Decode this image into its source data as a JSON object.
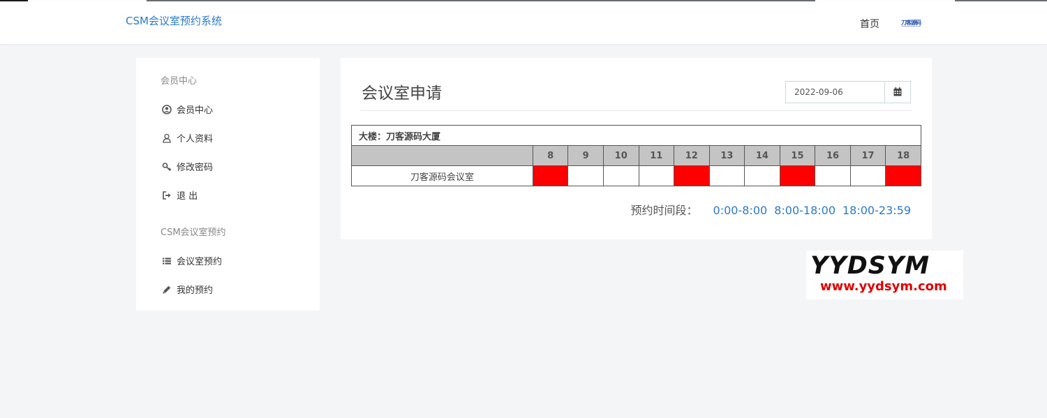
{
  "header": {
    "brand": "CSM会议室预约系统",
    "nav_home": "首页",
    "logo_text": "刀客源码"
  },
  "sidebar": {
    "section1_title": "会员中心",
    "section1_items": [
      {
        "label": "会员中心",
        "icon": "user-circle-icon"
      },
      {
        "label": "个人资料",
        "icon": "user-icon"
      },
      {
        "label": "修改密码",
        "icon": "key-icon"
      },
      {
        "label": "退 出",
        "icon": "sign-out-icon"
      }
    ],
    "section2_title": "CSM会议室预约",
    "section2_items": [
      {
        "label": "会议室预约",
        "icon": "list-icon"
      },
      {
        "label": "我的预约",
        "icon": "pencil-icon"
      }
    ]
  },
  "main": {
    "title": "会议室申请",
    "date_value": "2022-09-06",
    "building_label": "大楼：刀客源码大厦",
    "hours": [
      "8",
      "9",
      "10",
      "11",
      "12",
      "13",
      "14",
      "15",
      "16",
      "17",
      "18"
    ],
    "rooms": [
      {
        "name": "刀客源码会议室",
        "booked": [
          true,
          false,
          false,
          false,
          true,
          false,
          false,
          true,
          false,
          false,
          true
        ]
      }
    ],
    "legend_label": "预约时间段：",
    "periods": [
      "0:00-8:00",
      "8:00-18:00",
      "18:00-23:59"
    ]
  },
  "colors": {
    "brand": "#2a7ac8",
    "booked": "#ff0000",
    "header_bg": "#c4c4c4"
  },
  "watermark": {
    "title": "YYDSYM",
    "url": "www.yydsym.com"
  }
}
